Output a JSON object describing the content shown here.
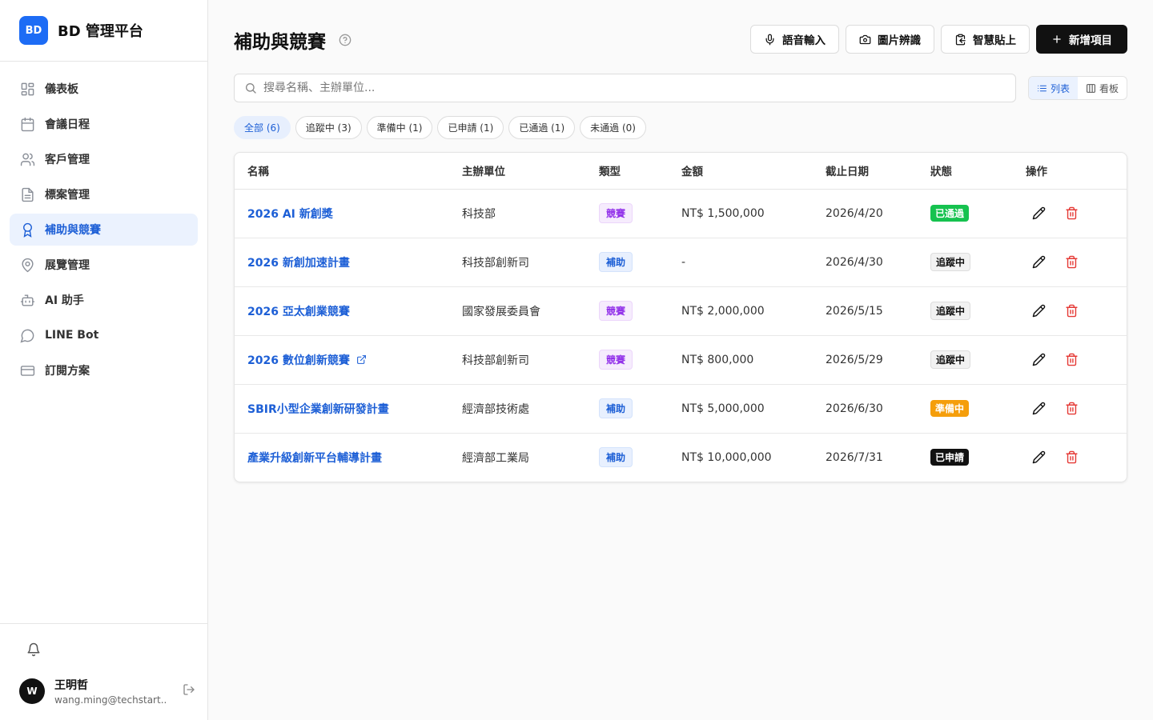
{
  "brand": {
    "logo": "BD",
    "name": "BD 管理平台"
  },
  "nav": [
    {
      "label": "儀表板",
      "icon": "dashboard-icon"
    },
    {
      "label": "會議日程",
      "icon": "calendar-icon"
    },
    {
      "label": "客戶管理",
      "icon": "users-icon"
    },
    {
      "label": "標案管理",
      "icon": "document-icon"
    },
    {
      "label": "補助與競賽",
      "icon": "award-icon",
      "active": true
    },
    {
      "label": "展覽管理",
      "icon": "map-pin-icon"
    },
    {
      "label": "AI 助手",
      "icon": "bot-icon"
    },
    {
      "label": "LINE Bot",
      "icon": "chat-icon"
    },
    {
      "label": "訂閱方案",
      "icon": "credit-card-icon"
    }
  ],
  "user": {
    "initial": "W",
    "name": "王明哲",
    "email": "wang.ming@techstart...."
  },
  "page": {
    "title": "補助與競賽"
  },
  "actions": {
    "voice": "語音輸入",
    "image": "圖片辨識",
    "paste": "智慧貼上",
    "add": "新增項目"
  },
  "search": {
    "placeholder": "搜尋名稱、主辦單位..."
  },
  "view": {
    "list": "列表",
    "board": "看板"
  },
  "filters": [
    "全部 (6)",
    "追蹤中 (3)",
    "準備中 (1)",
    "已申請 (1)",
    "已通過 (1)",
    "未通過 (0)"
  ],
  "table": {
    "headers": [
      "名稱",
      "主辦單位",
      "類型",
      "金額",
      "截止日期",
      "狀態",
      "操作"
    ],
    "rows": [
      {
        "name": "2026 AI 新創獎",
        "org": "科技部",
        "type": "競賽",
        "amount": "NT$ 1,500,000",
        "deadline": "2026/4/20",
        "status": "已通過"
      },
      {
        "name": "2026 新創加速計畫",
        "org": "科技部創新司",
        "type": "補助",
        "amount": "-",
        "deadline": "2026/4/30",
        "status": "追蹤中"
      },
      {
        "name": "2026 亞太創業競賽",
        "org": "國家發展委員會",
        "type": "競賽",
        "amount": "NT$ 2,000,000",
        "deadline": "2026/5/15",
        "status": "追蹤中"
      },
      {
        "name": "2026 數位創新競賽",
        "org": "科技部創新司",
        "type": "競賽",
        "amount": "NT$ 800,000",
        "deadline": "2026/5/29",
        "status": "追蹤中",
        "external": true
      },
      {
        "name": "SBIR小型企業創新研發計畫",
        "org": "經濟部技術處",
        "type": "補助",
        "amount": "NT$ 5,000,000",
        "deadline": "2026/6/30",
        "status": "準備中"
      },
      {
        "name": "產業升級創新平台輔導計畫",
        "org": "經濟部工業局",
        "type": "補助",
        "amount": "NT$ 10,000,000",
        "deadline": "2026/7/31",
        "status": "已申請"
      }
    ]
  },
  "colors": {
    "accent": "#1d5fd6",
    "brand": "#1d6cf5",
    "passed": "#16c24f",
    "preparing": "#f59e0b",
    "delete": "#e53935"
  }
}
